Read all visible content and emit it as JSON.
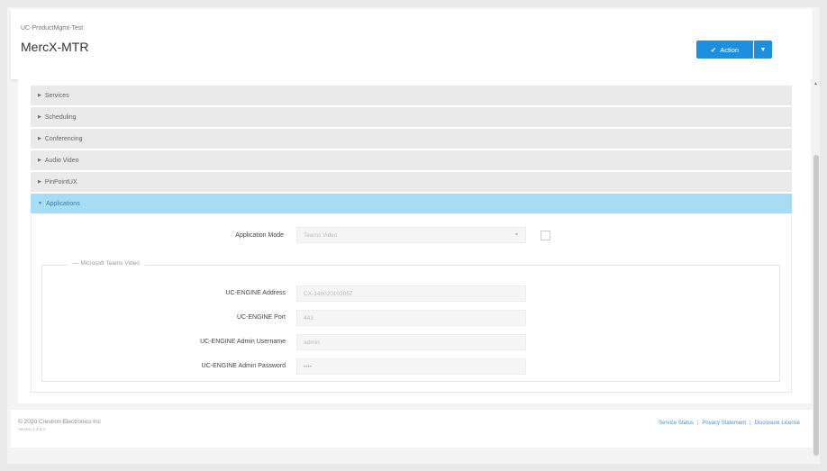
{
  "header": {
    "breadcrumb": "UC-ProductMgmt-Test",
    "title": "MercX-MTR",
    "action_label": "Action",
    "action_check_icon": "check-icon",
    "dropdown_icon": "caret-down-icon"
  },
  "accordion": {
    "items": [
      {
        "label": "Services"
      },
      {
        "label": "Scheduling"
      },
      {
        "label": "Conferencing"
      },
      {
        "label": "Audio Video"
      },
      {
        "label": "PinPointUX"
      },
      {
        "label": "Applications"
      }
    ],
    "active_index": 5
  },
  "applications": {
    "mode_label": "Application Mode",
    "mode_value": "Teams Video",
    "group_title": "Microsoft Teams Video",
    "fields": [
      {
        "label": "UC-ENGINE Address",
        "value": "CX-146020103057"
      },
      {
        "label": "UC-ENGINE Port",
        "value": "443"
      },
      {
        "label": "UC-ENGINE Admin Username",
        "value": "admin"
      },
      {
        "label": "UC-ENGINE Admin Password",
        "value": "••••"
      }
    ]
  },
  "footer": {
    "copyright": "© 2020 Crestron Electronics Inc",
    "version": "Version 1.2.3.4",
    "links": [
      "Service Status",
      "Privacy Statement",
      "Disclosure License"
    ]
  },
  "colors": {
    "accent": "#1d8fe0",
    "active_row": "#a6dcf4",
    "link": "#4a8dd0"
  }
}
